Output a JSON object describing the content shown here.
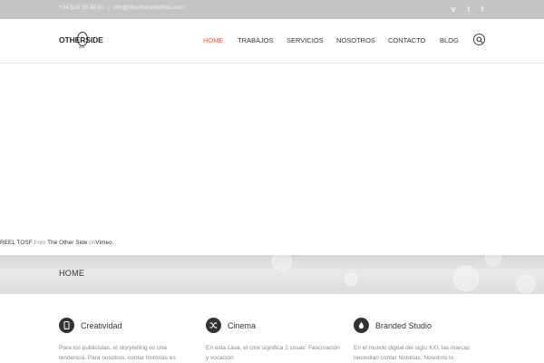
{
  "topbar": {
    "phone": "+34 618 38 38 81",
    "separator": "|",
    "email": "info@theothersidefilms.com",
    "social": [
      "vimeo-icon",
      "twitter-icon",
      "facebook-icon"
    ],
    "social_glyphs": [
      "v",
      "t",
      "f"
    ]
  },
  "header": {
    "logo_text": "OTHERSIDE",
    "logo_tag": "films",
    "nav": [
      {
        "label": "HOME",
        "active": true
      },
      {
        "label": "TRABAJOS",
        "active": false
      },
      {
        "label": "SERVICIOS",
        "active": false
      },
      {
        "label": "NOSOTROS",
        "active": false
      },
      {
        "label": "CONTACTO",
        "active": false
      },
      {
        "label": "BLOG",
        "active": false
      }
    ],
    "active_color": "#e0624b"
  },
  "video": {
    "credit_title": "REEL TOSF",
    "credit_from": "from",
    "credit_author": "The Other Side",
    "credit_on": "on",
    "credit_platform": "Vimeo",
    "credit_end": "."
  },
  "band": {
    "title": "HOME"
  },
  "features": [
    {
      "icon": "tablet-icon",
      "title": "Creatividad",
      "text": "Para los publicistas, el storytelling es una tendencia. Para nosotros, contar historias es"
    },
    {
      "icon": "shuffle-icon",
      "title": "Cinema",
      "text": "En esta casa, el cine significa 2 cosas: Fascinación y vocación"
    },
    {
      "icon": "drop-icon",
      "title": "Branded Studio",
      "text": "En el mundo digital del siglo XXI, las marcas necesitan contar historias. Nosotros lo"
    }
  ]
}
